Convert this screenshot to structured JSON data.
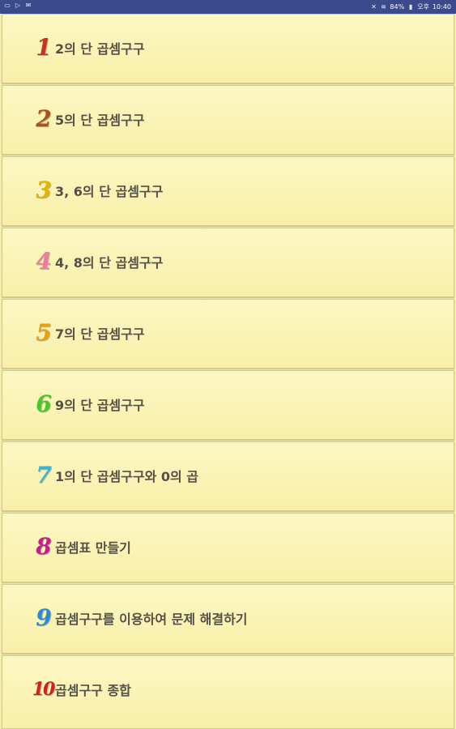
{
  "status_bar": {
    "left_icons": [
      "app-icon",
      "play-icon",
      "mail-icon"
    ],
    "battery": "84%",
    "ampm": "오후",
    "time": "10:40"
  },
  "menu": {
    "items": [
      {
        "num": "1",
        "label": "2의 단 곱셈구구",
        "color": "#c8321e"
      },
      {
        "num": "2",
        "label": "5의 단 곱셈구구",
        "color": "#a8541a"
      },
      {
        "num": "3",
        "label": "3, 6의 단 곱셈구구",
        "color": "#e4b400"
      },
      {
        "num": "4",
        "label": "4, 8의 단 곱셈구구",
        "color": "#f07aa0"
      },
      {
        "num": "5",
        "label": "7의 단 곱셈구구",
        "color": "#e8a010"
      },
      {
        "num": "6",
        "label": "9의 단 곱셈구구",
        "color": "#48c828"
      },
      {
        "num": "7",
        "label": "1의 단 곱셈구구와 0의 곱",
        "color": "#3ab4d8"
      },
      {
        "num": "8",
        "label": "곱셈표 만들기",
        "color": "#c02090"
      },
      {
        "num": "9",
        "label": "곱셈구구를 이용하여 문제 해결하기",
        "color": "#2a8ad8"
      },
      {
        "num": "10",
        "label": "곱셈구구 종합",
        "color": "#d22020"
      }
    ]
  }
}
